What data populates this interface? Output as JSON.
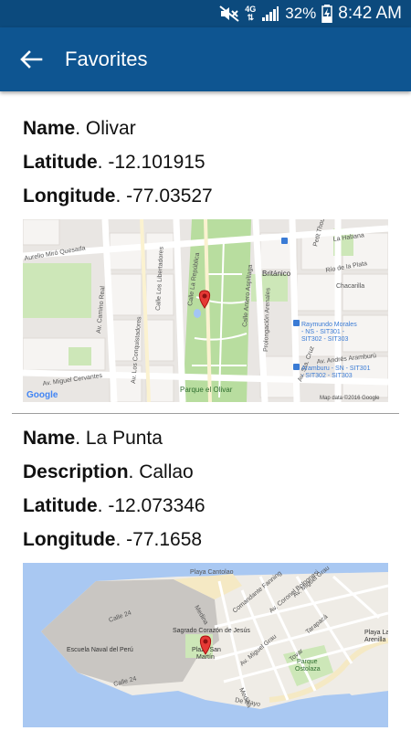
{
  "status_bar": {
    "battery": "32%",
    "time": "8:42 AM",
    "network": "4G"
  },
  "app_bar": {
    "title": "Favorites"
  },
  "favorites": [
    {
      "name_label": "Name",
      "name": ". Olivar",
      "lat_label": "Latitude",
      "lat": ". -12.101915",
      "lon_label": "Longitude",
      "lon": ". -77.03527",
      "map": {
        "streets": [
          "Aurelio Miró Quesada",
          "Av. Camino Real",
          "Calle Los Libertadores",
          "Av. Los Conquistadores",
          "Calle La República",
          "Calle Antero Aspíllaga",
          "Prolongación Arenales",
          "Petit Thouars",
          "La Habana",
          "Río de la Plata",
          "Chacarilla",
          "Av. Miguel Cervantes",
          "Av. Andrés Aramburú",
          "Av. Sta. Cruz"
        ],
        "places": [
          "Británico",
          "Parque el Olivar"
        ],
        "transit": [
          "Raymundo Morales - NS - SIT301 - SIT302 - SIT303",
          "Aramburu - SN - SIT301 - SIT302 - SIT303"
        ],
        "attribution": "Map data ©2016 Google",
        "logo": "Google"
      }
    },
    {
      "name_label": "Name",
      "name": ". La Punta",
      "desc_label": "Description",
      "desc": ". Callao",
      "lat_label": "Latitude",
      "lat": ". -12.073346",
      "lon_label": "Longitude",
      "lon": ". -77.1658",
      "map": {
        "streets": [
          "Playa Cantolao",
          "Calle 24",
          "Medina",
          "Comandante Fanning",
          "Av. Coronel Bolognesi",
          "Av. Miguel Grau",
          "Tarapacá",
          "Tovar",
          "De Mayo",
          "Av. Miguel Grau"
        ],
        "places": [
          "Escuela Naval del Perú",
          "Sagrado Corazón de Jesús",
          "Plaza San Martín",
          "Parque Ostolaza",
          "Playa La Arenilla"
        ]
      }
    }
  ]
}
